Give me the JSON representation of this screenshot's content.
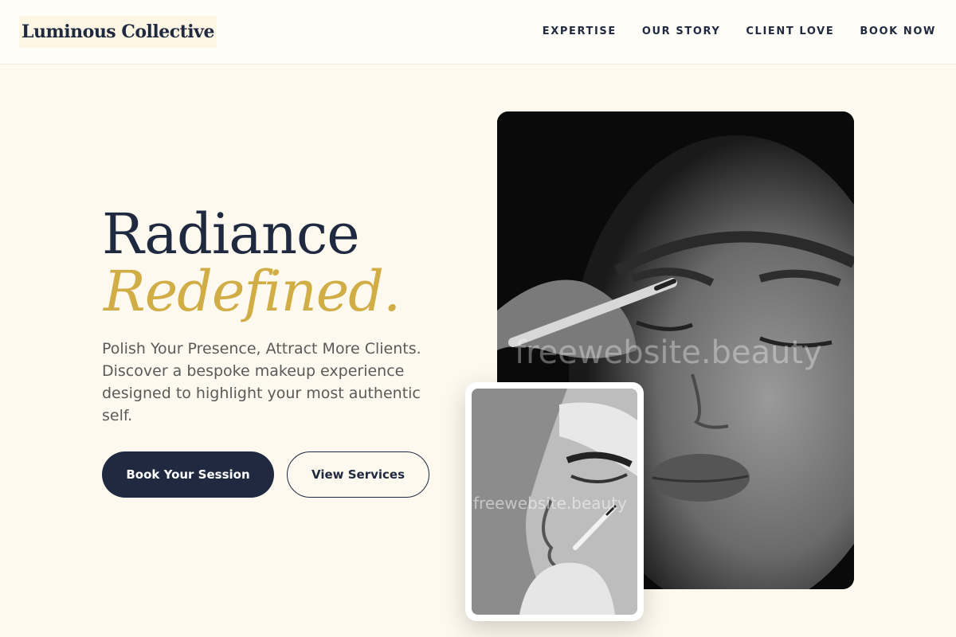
{
  "brand": {
    "name": "Luminous Collective"
  },
  "nav": {
    "items": [
      {
        "label": "EXPERTISE"
      },
      {
        "label": "OUR STORY"
      },
      {
        "label": "CLIENT LOVE"
      },
      {
        "label": "BOOK NOW"
      }
    ]
  },
  "hero": {
    "title_line1": "Radiance",
    "title_line2": "Redefined.",
    "subtitle": "Polish Your Presence, Attract More Clients. Discover a bespoke makeup experience designed to highlight your most authentic self.",
    "primary_button": "Book Your Session",
    "secondary_button": "View Services"
  },
  "images": {
    "main_watermark": "freewebsite.beauty",
    "inset_watermark": "freewebsite.beauty"
  },
  "colors": {
    "background": "#fdf9ee",
    "navy": "#1f2a40",
    "gold": "#d1ad45"
  }
}
